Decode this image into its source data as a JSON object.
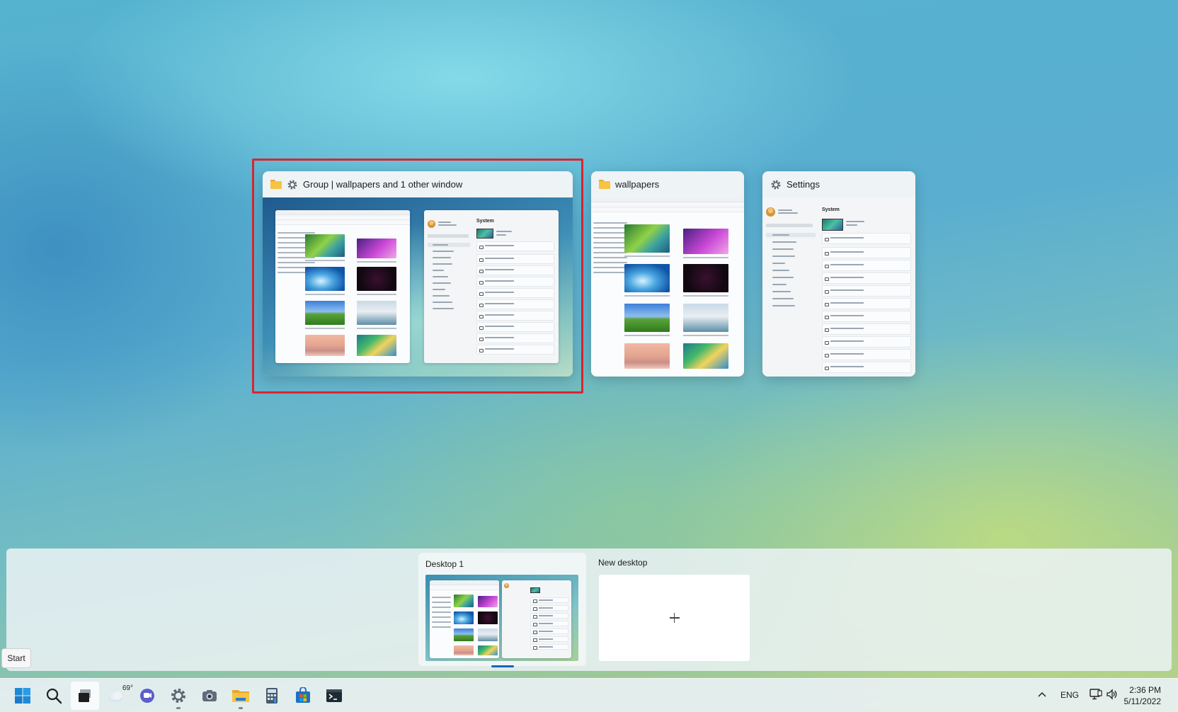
{
  "task_view": {
    "windows": [
      {
        "title": "Group | wallpapers and 1 other window",
        "selected": true
      },
      {
        "title": "wallpapers",
        "selected": false
      },
      {
        "title": "Settings",
        "selected": false
      }
    ],
    "mini_settings": {
      "heading": "System"
    }
  },
  "desktops": {
    "items": [
      {
        "label": "Desktop 1",
        "current": true
      }
    ],
    "new_desktop_label": "New desktop"
  },
  "tooltip": {
    "text": "Start"
  },
  "taskbar": {
    "apps": [
      {
        "name": "start-icon"
      },
      {
        "name": "search-icon"
      },
      {
        "name": "task-view-icon",
        "active": true
      },
      {
        "name": "weather-icon",
        "temp": "69°"
      },
      {
        "name": "teams-chat-icon"
      },
      {
        "name": "settings-icon",
        "running": true
      },
      {
        "name": "camera-icon"
      },
      {
        "name": "file-explorer-icon",
        "running": true
      },
      {
        "name": "calculator-icon"
      },
      {
        "name": "store-icon"
      },
      {
        "name": "terminal-icon"
      }
    ],
    "tray": {
      "language": "ENG",
      "time": "2:36 PM",
      "date": "5/11/2022"
    }
  },
  "colors": {
    "selection_border": "#d8262f",
    "accent": "#1466b8"
  }
}
